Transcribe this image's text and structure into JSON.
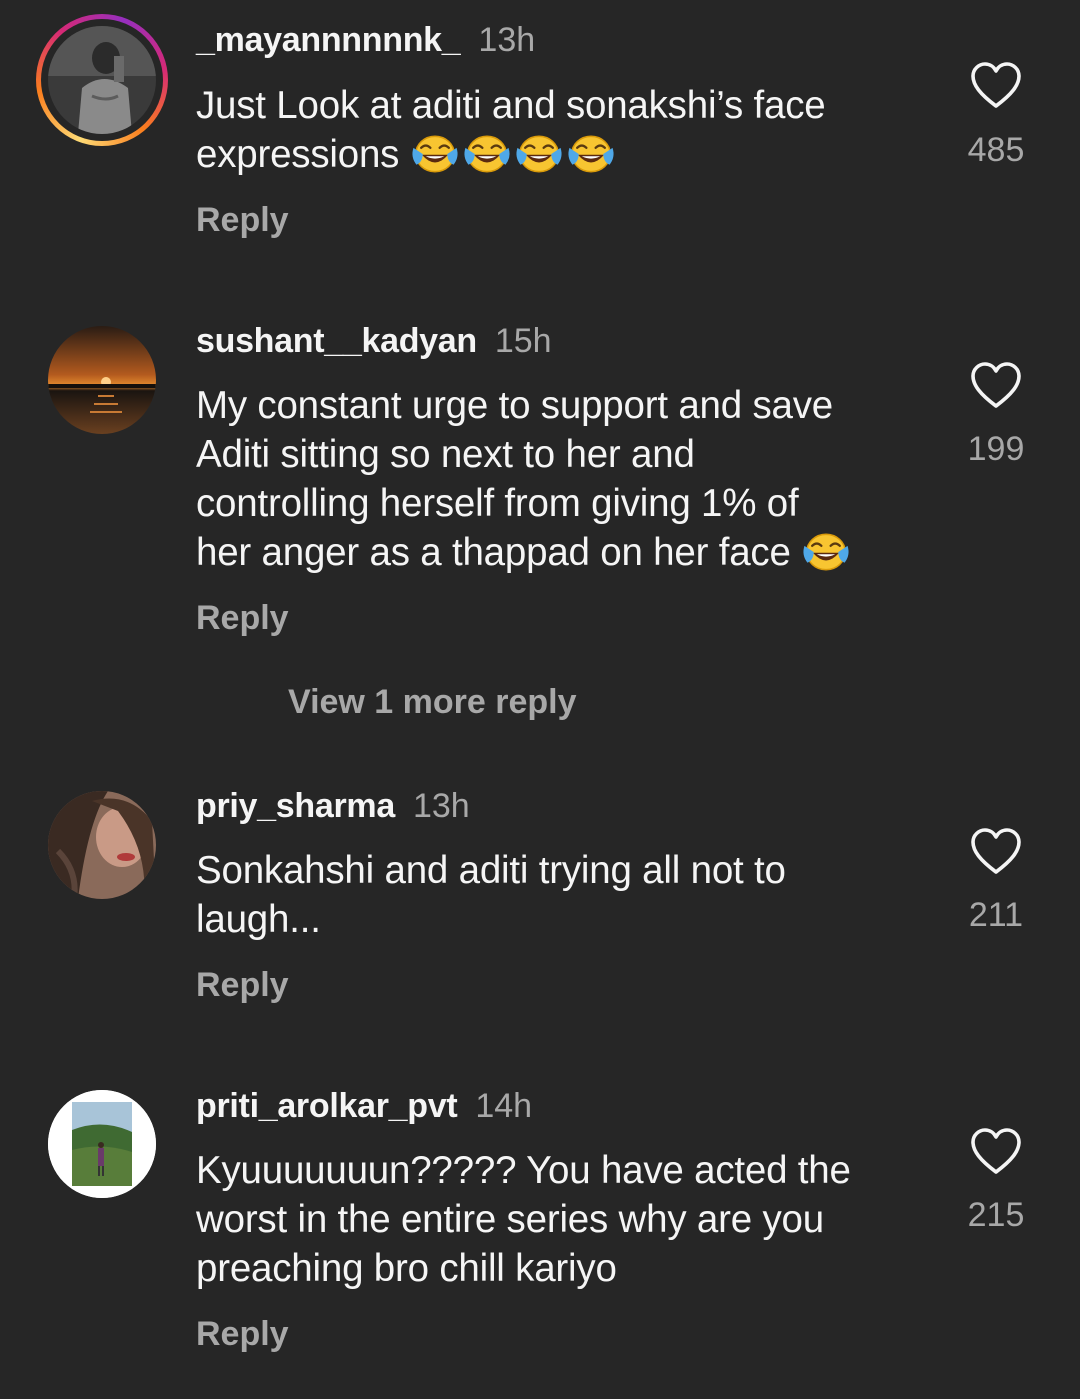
{
  "comments": [
    {
      "username": "_mayannnnnnk_",
      "time": "13h",
      "text": "Just Look at aditi and sonakshi’s face expressions",
      "emoji_count": 4,
      "likes": "485",
      "reply_label": "Reply",
      "has_story_ring": true
    },
    {
      "username": "sushant__kadyan",
      "time": "15h",
      "text_lines": [
        "My constant urge to support and save",
        "Aditi sitting so next to her and",
        "controlling herself from giving 1% of",
        "her anger as a thappad on her face"
      ],
      "emoji_count": 1,
      "likes": "199",
      "reply_label": "Reply",
      "view_more_label": "View 1 more reply"
    },
    {
      "username": "priy_sharma",
      "time": "13h",
      "text_lines": [
        "Sonkahshi and aditi trying all not to",
        "laugh..."
      ],
      "likes": "211",
      "reply_label": "Reply"
    },
    {
      "username": "priti_arolkar_pvt",
      "time": "14h",
      "text_lines": [
        "Kyuuuuuuun????? You have acted the",
        "worst in the entire series why are you",
        "preaching bro chill kariyo"
      ],
      "likes": "215",
      "reply_label": "Reply"
    }
  ],
  "icons": {
    "like": "heart-outline-icon",
    "emoji": "face-with-tears-of-joy-emoji"
  },
  "colors": {
    "background": "#262626",
    "primary_text": "#f5f5f5",
    "secondary_text": "#a8a8a8"
  }
}
